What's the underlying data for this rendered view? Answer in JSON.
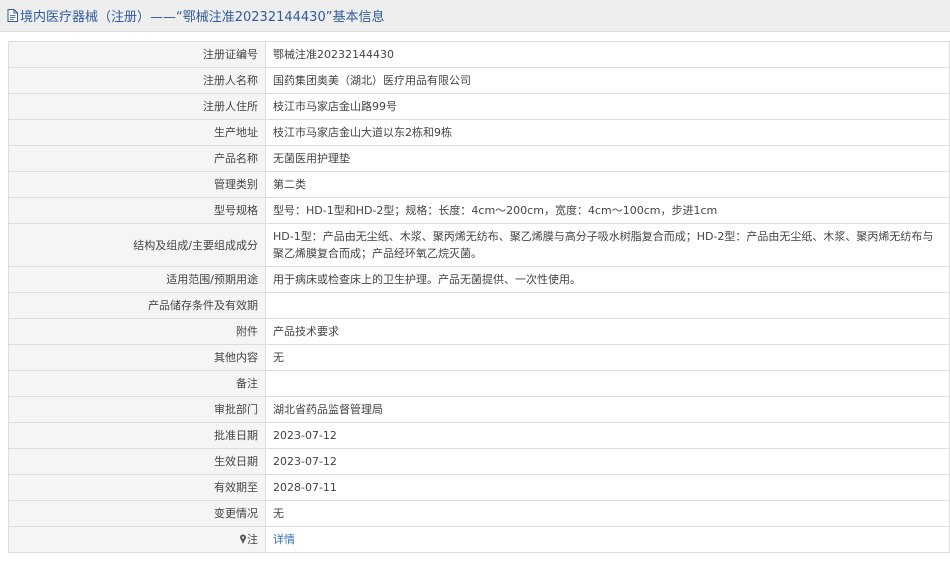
{
  "header": {
    "icon": "document-icon",
    "title": "境内医疗器械（注册）——“鄂械注准20232144430”基本信息"
  },
  "rows": [
    {
      "label": "注册证编号",
      "value": "鄂械注准20232144430"
    },
    {
      "label": "注册人名称",
      "value": "国药集团奥美（湖北）医疗用品有限公司"
    },
    {
      "label": "注册人住所",
      "value": "枝江市马家店金山路99号"
    },
    {
      "label": "生产地址",
      "value": "枝江市马家店金山大道以东2栋和9栋"
    },
    {
      "label": "产品名称",
      "value": "无菌医用护理垫"
    },
    {
      "label": "管理类别",
      "value": "第二类"
    },
    {
      "label": "型号规格",
      "value": "型号：HD-1型和HD-2型；规格：长度：4cm～200cm，宽度：4cm～100cm，步进1cm"
    },
    {
      "label": "结构及组成/主要组成成分",
      "value": "HD-1型：产品由无尘纸、木浆、聚丙烯无纺布、聚乙烯膜与高分子吸水树脂复合而成；HD-2型：产品由无尘纸、木浆、聚丙烯无纺布与聚乙烯膜复合而成；产品经环氧乙烷灭菌。"
    },
    {
      "label": "适用范围/预期用途",
      "value": "用于病床或检查床上的卫生护理。产品无菌提供、一次性使用。"
    },
    {
      "label": "产品储存条件及有效期",
      "value": ""
    },
    {
      "label": "附件",
      "value": "产品技术要求"
    },
    {
      "label": "其他内容",
      "value": "无"
    },
    {
      "label": "备注",
      "value": ""
    },
    {
      "label": "审批部门",
      "value": "湖北省药品监督管理局"
    },
    {
      "label": "批准日期",
      "value": "2023-07-12"
    },
    {
      "label": "生效日期",
      "value": "2023-07-12"
    },
    {
      "label": "有效期至",
      "value": "2028-07-11"
    },
    {
      "label": "变更情况",
      "value": "无"
    }
  ],
  "note_row": {
    "icon": "pin-icon",
    "label": "注",
    "link": "详情"
  },
  "colors": {
    "title": "#2f5c9e",
    "link": "#2f6fb8",
    "label_bg": "#f5f5f5",
    "border": "#dddddd",
    "header_bg": "#eeeeee"
  }
}
